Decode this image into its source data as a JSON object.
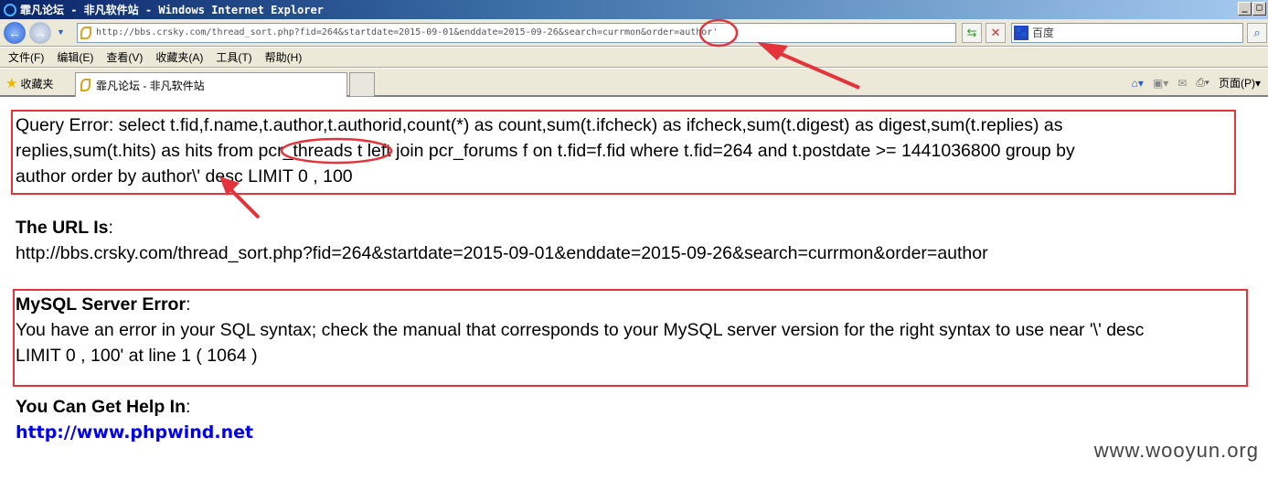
{
  "window": {
    "title": "霏凡论坛 - 非凡软件站 - Windows Internet Explorer"
  },
  "address": {
    "url": "http://bbs.crsky.com/thread_sort.php?fid=264&startdate=2015-09-01&enddate=2015-09-26&search=currmon&order=author'"
  },
  "search": {
    "provider": "百度"
  },
  "menu": [
    "文件(F)",
    "编辑(E)",
    "查看(V)",
    "收藏夹(A)",
    "工具(T)",
    "帮助(H)"
  ],
  "favorites": {
    "label": "收藏夹",
    "tab": "霏凡论坛 - 非凡软件站",
    "page_menu": "页面(P)"
  },
  "content": {
    "query_error": [
      "Query Error: select t.fid,f.name,t.author,t.authorid,count(*) as count,sum(t.ifcheck) as ifcheck,sum(t.digest) as digest,sum(t.replies) as",
      "replies,sum(t.hits) as hits from pcr_threads t left join pcr_forums f on t.fid=f.fid where t.fid=264 and t.postdate >= 1441036800 group by",
      "author order by author\\' desc LIMIT 0 , 100"
    ],
    "url_heading": "The URL Is",
    "url": "http://bbs.crsky.com/thread_sort.php?fid=264&startdate=2015-09-01&enddate=2015-09-26&search=currmon&order=author",
    "mysql_heading": "MySQL Server Error",
    "mysql_error": [
      "You have an error in your SQL syntax; check the manual that corresponds to your MySQL server version for the right syntax to use near '\\' desc",
      "LIMIT 0 , 100' at line 1 ( 1064 )"
    ],
    "help_heading": "You Can Get Help In",
    "help_link": "http://www.phpwind.net",
    "colon": ":"
  },
  "watermark": "www.wooyun.org",
  "colors": {
    "annotation": "#e3343c",
    "link": "#0000ee"
  }
}
